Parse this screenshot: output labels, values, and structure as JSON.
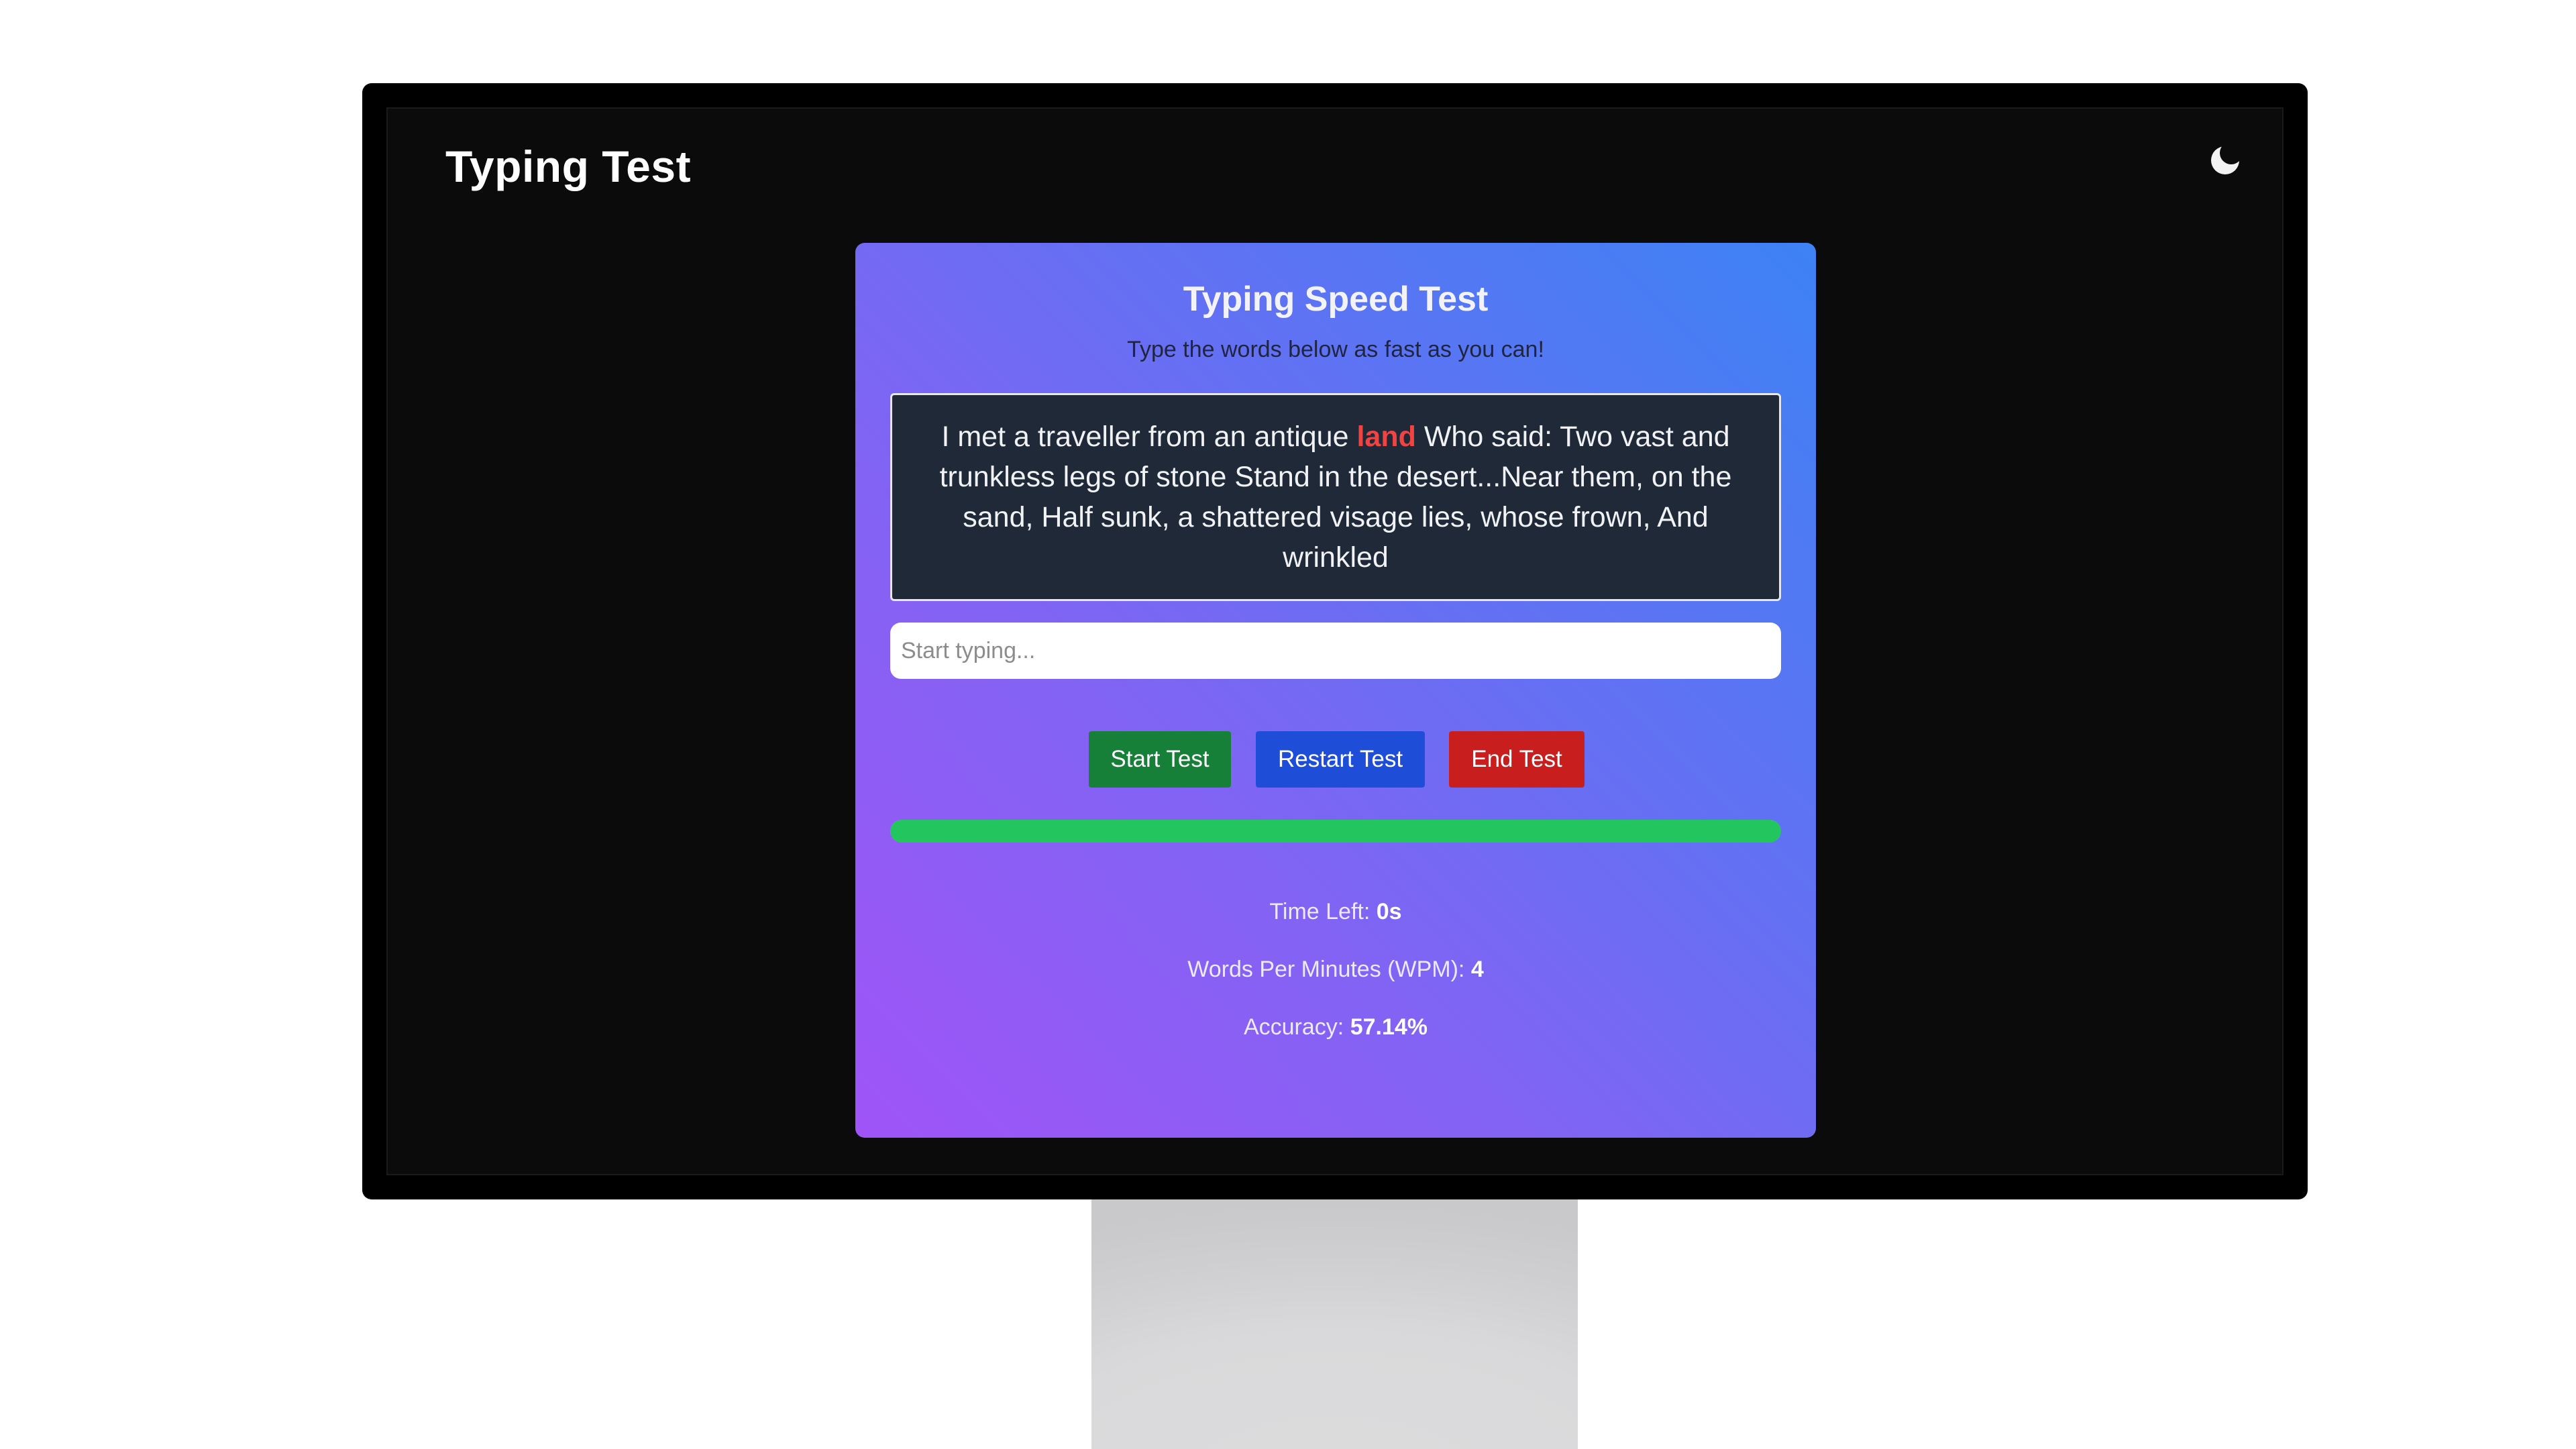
{
  "app": {
    "title": "Typing Test",
    "theme_icon": "moon-icon"
  },
  "card": {
    "title": "Typing Speed Test",
    "subtitle": "Type the words below as fast as you can!",
    "passage": {
      "before": "I met a traveller from an antique ",
      "current_word": "land",
      "after": " Who said: Two vast and trunkless legs of stone Stand in the desert...Near them, on the sand, Half sunk, a shattered visage lies, whose frown, And wrinkled"
    },
    "input": {
      "placeholder": "Start typing...",
      "value": ""
    },
    "buttons": {
      "start": "Start Test",
      "restart": "Restart Test",
      "end": "End Test"
    },
    "progress": {
      "percent": 100,
      "color": "#22c55e"
    },
    "stats": {
      "time_left_label": "Time Left:",
      "time_left_value": "0s",
      "wpm_label": "Words Per Minutes (WPM):",
      "wpm_value": "4",
      "accuracy_label": "Accuracy:",
      "accuracy_value": "57.14%"
    }
  },
  "colors": {
    "start_button": "#178038",
    "restart_button": "#1e4ed8",
    "end_button": "#c81e1e",
    "highlight_word": "#ef4444"
  }
}
